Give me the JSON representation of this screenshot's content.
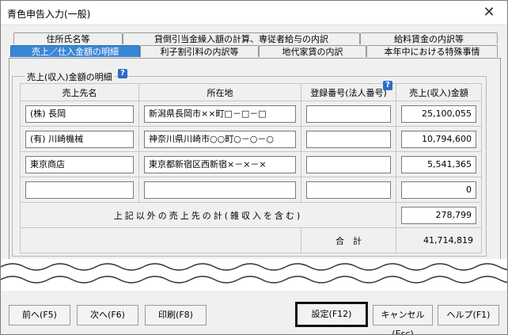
{
  "window": {
    "title": "青色申告入力(一般)"
  },
  "tabs_row1": [
    {
      "label": "住所氏名等"
    },
    {
      "label": "貸倒引当金繰入額の計算、専従者給与の内訳"
    },
    {
      "label": "給料賃金の内訳等"
    }
  ],
  "tabs_row2": [
    {
      "label": "売上／仕入金額の明細",
      "active": true
    },
    {
      "label": "利子割引料の内訳等"
    },
    {
      "label": "地代家賃の内訳"
    },
    {
      "label": "本年中における特殊事情"
    }
  ],
  "group": {
    "label": "売上(収入)金額の明細",
    "help": "?"
  },
  "table": {
    "headers": {
      "name": "売上先名",
      "address": "所在地",
      "reg": "登録番号(法人番号)",
      "amount": "売上(収入)金額"
    },
    "header_help": "?",
    "rows": [
      {
        "name": "(株) 長岡",
        "address": "新潟県長岡市××町□－□－□",
        "reg": "",
        "amount": "25,100,055"
      },
      {
        "name": "(有) 川崎機械",
        "address": "神奈川県川崎市○○町○－○－○",
        "reg": "",
        "amount": "10,794,600"
      },
      {
        "name": "東京商店",
        "address": "東京都新宿区西新宿×－×－×",
        "reg": "",
        "amount": "5,541,365"
      },
      {
        "name": "",
        "address": "",
        "reg": "",
        "amount": "0"
      }
    ],
    "other_label": "上記以外の売上先の計(雑収入を含む)",
    "other_amount": "278,799",
    "total_label": "合　計",
    "total_amount": "41,714,819"
  },
  "buttons": {
    "prev": "前へ(F5)",
    "next": "次へ(F6)",
    "print": "印刷(F8)",
    "settings": "設定(F12)",
    "cancel": "キャンセル(Esc)",
    "help": "ヘルプ(F1)"
  },
  "icons": {
    "close": "close-icon",
    "help": "help-icon"
  },
  "colors": {
    "active_tab": "#3a86d6",
    "help_icon": "#2d6dc7"
  }
}
